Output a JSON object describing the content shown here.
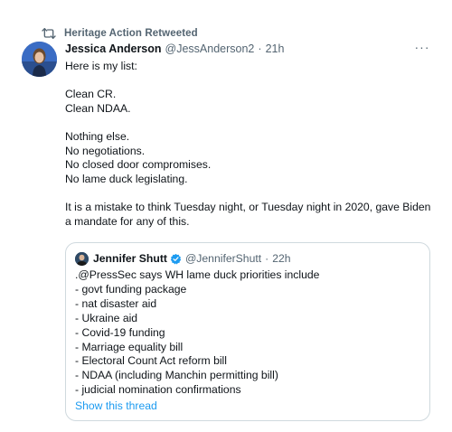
{
  "retweet": {
    "label": "Heritage Action Retweeted",
    "icon": "retweet-icon"
  },
  "tweet": {
    "author_name": "Jessica Anderson",
    "author_handle": "@JessAnderson2",
    "separator": "·",
    "time": "21h",
    "more": "···",
    "paragraphs": [
      [
        "Here is my list:"
      ],
      [
        "Clean CR.",
        "Clean NDAA."
      ],
      [
        "Nothing else.",
        "No negotiations.",
        "No closed door compromises.",
        "No lame duck legislating."
      ],
      [
        "It is a mistake to think Tuesday night, or Tuesday night in 2020, gave Biden",
        "a mandate for any of this."
      ]
    ]
  },
  "quote": {
    "author_name": "Jennifer Shutt",
    "author_handle": "@JenniferShutt",
    "separator": "·",
    "time": "22h",
    "lines": [
      ".@PressSec says WH lame duck priorities include",
      "- govt funding package",
      "- nat disaster aid",
      "- Ukraine aid",
      "- Covid-19 funding",
      "- Marriage equality bill",
      "- Electoral Count Act reform bill",
      "- NDAA (including Manchin permitting bill)",
      "- judicial nomination confirmations"
    ],
    "show_thread": "Show this thread"
  },
  "colors": {
    "text": "#0f1419",
    "secondary": "#536471",
    "link": "#1d9bf0",
    "border": "#cfd9de"
  }
}
